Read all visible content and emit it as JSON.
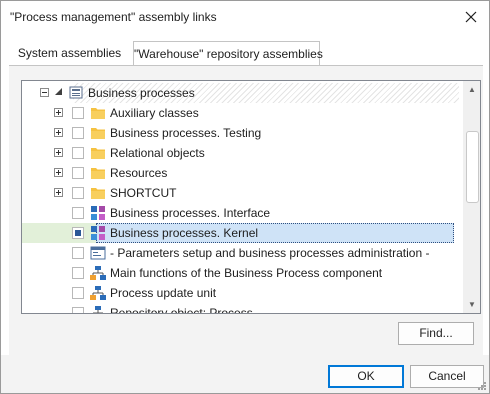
{
  "window": {
    "title": "\"Process management\" assembly links"
  },
  "tabs": [
    {
      "label": "System assemblies",
      "active": false
    },
    {
      "label": "\"Warehouse\" repository assemblies",
      "active": true
    }
  ],
  "tree": {
    "root": {
      "label": "Business processes",
      "icon": "repository-icon",
      "expanded": true
    },
    "items": [
      {
        "label": "Auxiliary classes",
        "icon": "folder-icon",
        "expandable": true,
        "checked": false
      },
      {
        "label": "Business processes. Testing",
        "icon": "folder-icon",
        "expandable": true,
        "checked": false
      },
      {
        "label": "Relational objects",
        "icon": "folder-icon",
        "expandable": true,
        "checked": false
      },
      {
        "label": "Resources",
        "icon": "folder-icon",
        "expandable": true,
        "checked": false
      },
      {
        "label": "SHORTCUT",
        "icon": "folder-icon",
        "expandable": true,
        "checked": false
      },
      {
        "label": "Business processes. Interface",
        "icon": "assembly-icon",
        "expandable": false,
        "checked": false
      },
      {
        "label": "Business processes. Kernel",
        "icon": "assembly-icon",
        "expandable": false,
        "checked": true,
        "selected": true
      },
      {
        "label": "- Parameters setup and business processes administration -",
        "icon": "form-icon",
        "expandable": false,
        "checked": false
      },
      {
        "label": "Main functions of the Business Process component",
        "icon": "process-icon",
        "expandable": false,
        "checked": false
      },
      {
        "label": "Process update unit",
        "icon": "process-icon",
        "expandable": false,
        "checked": false
      },
      {
        "label": "Repository object: Process",
        "icon": "process-icon",
        "expandable": false,
        "checked": false
      }
    ]
  },
  "buttons": {
    "find": "Find...",
    "ok": "OK",
    "cancel": "Cancel"
  },
  "colors": {
    "accent": "#0078d7",
    "folder": "#f5c242",
    "selection": "#cfe3f7",
    "selection_band": "#e2f0d9"
  }
}
